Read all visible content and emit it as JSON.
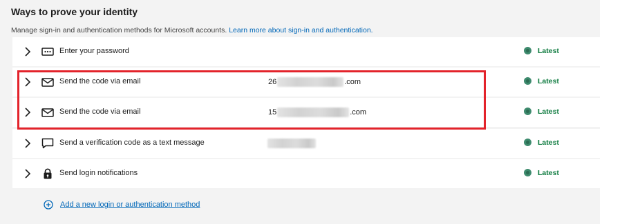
{
  "header": {
    "title": "Ways to prove your identity",
    "subtitle": "Manage sign-in and authentication methods for Microsoft accounts.",
    "learn_more_link": "Learn more about sign-in and authentication."
  },
  "methods": [
    {
      "label": "Enter your password",
      "icon": "password-icon",
      "value_prefix": "",
      "value_suffix": "",
      "status": "Latest"
    },
    {
      "label": "Send the code via email",
      "icon": "mail-icon",
      "value_prefix": "26",
      "value_suffix": ".com",
      "status": "Latest"
    },
    {
      "label": "Send the code via email",
      "icon": "mail-icon",
      "value_prefix": "15",
      "value_suffix": ".com",
      "status": "Latest"
    },
    {
      "label": "Send a verification code as a text message",
      "icon": "chat-icon",
      "value_prefix": "",
      "value_suffix": "",
      "status": "Latest"
    },
    {
      "label": "Send login notifications",
      "icon": "lock-icon",
      "value_prefix": "",
      "value_suffix": "",
      "status": "Latest"
    }
  ],
  "add_method": {
    "label": "Add a new login or authentication method",
    "icon": "add-circle-icon"
  },
  "colors": {
    "accent": "#0067b8",
    "status_green": "#107c41",
    "highlight": "#e3232b",
    "panel_bg": "#f3f3f3"
  }
}
